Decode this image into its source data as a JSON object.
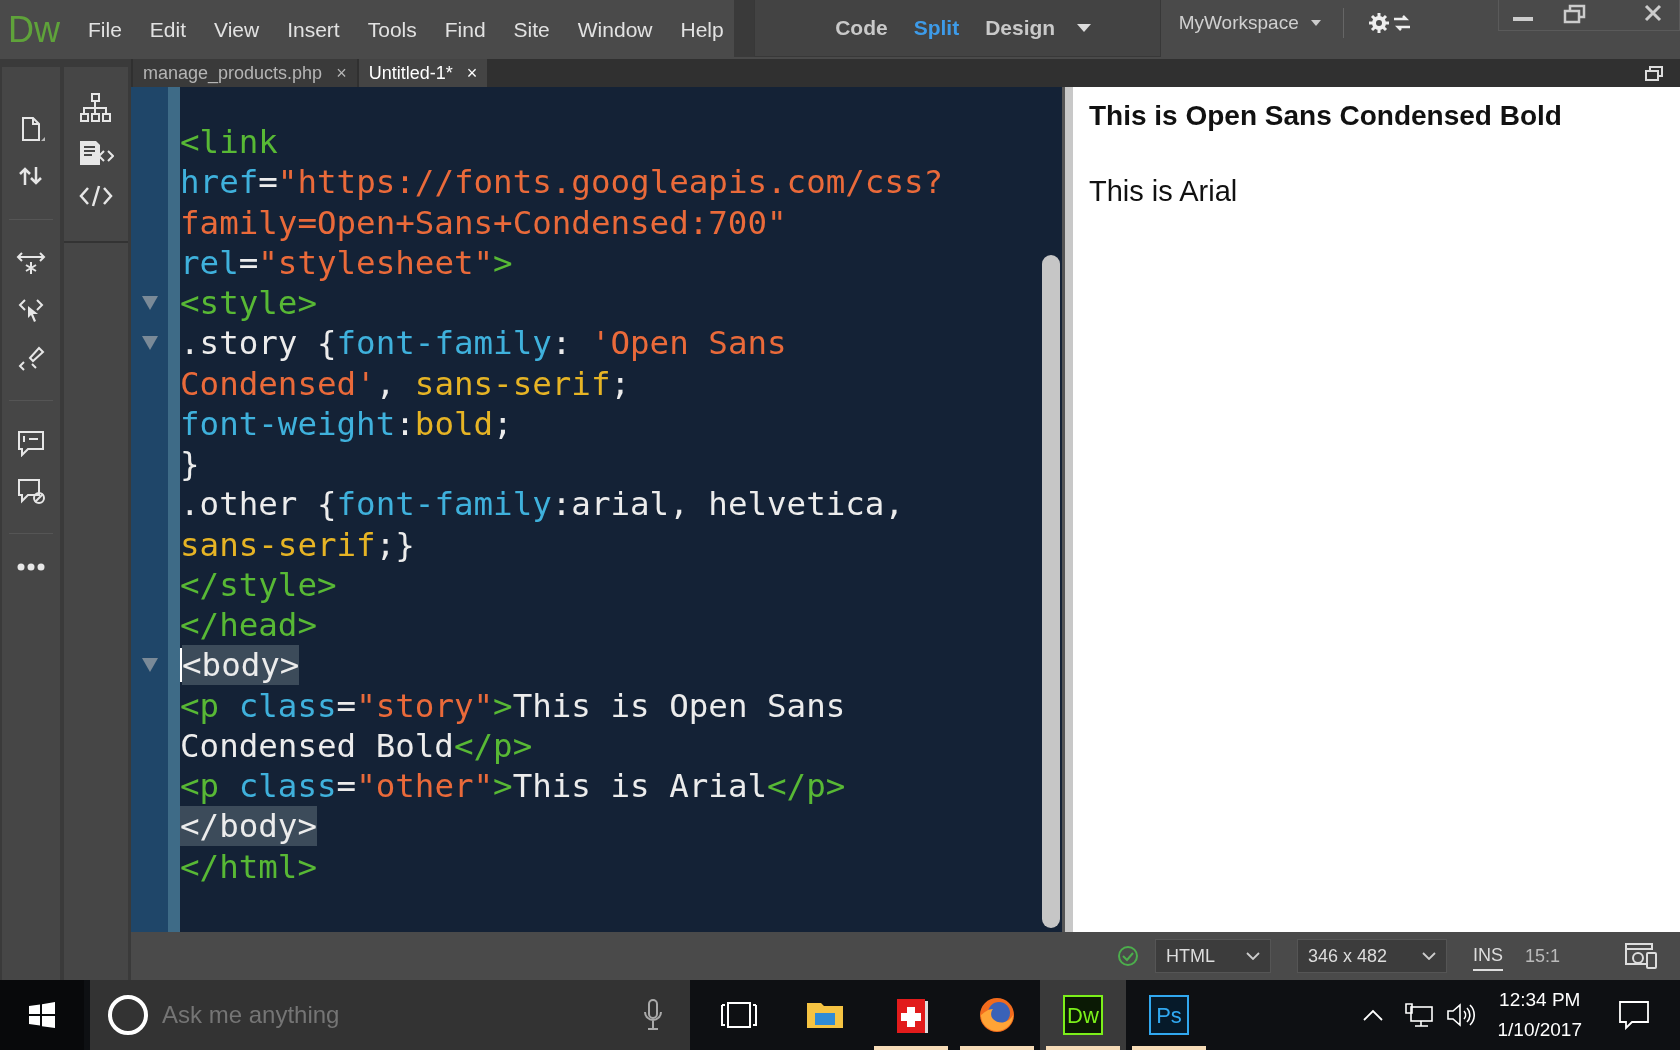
{
  "menu_bar": {
    "logo": "Dw",
    "items": [
      "File",
      "Edit",
      "View",
      "Insert",
      "Tools",
      "Find",
      "Site",
      "Window",
      "Help"
    ]
  },
  "view_switcher": [
    {
      "label": "Code",
      "selected": false
    },
    {
      "label": "Split",
      "selected": true
    },
    {
      "label": "Design",
      "selected": false
    }
  ],
  "workspace": "MyWorkspace",
  "tabs": [
    {
      "label": "manage_products.php",
      "close": "×",
      "selected": false
    },
    {
      "label": "Untitled-1*",
      "close": "×",
      "selected": true
    }
  ],
  "code": {
    "lines": [
      {
        "fold": false,
        "highlighted": false,
        "cursor": false,
        "tokens": [
          {
            "kind": "tag",
            "text": "<link"
          }
        ]
      },
      {
        "fold": false,
        "highlighted": false,
        "cursor": false,
        "tokens": [
          {
            "kind": "attr",
            "text": "href"
          },
          {
            "kind": "plain",
            "text": "="
          },
          {
            "kind": "string",
            "text": "\"https://fonts.googleapis.com/css?"
          }
        ]
      },
      {
        "fold": false,
        "highlighted": false,
        "cursor": false,
        "tokens": [
          {
            "kind": "string",
            "text": "family=Open+Sans+Condensed:700\""
          }
        ]
      },
      {
        "fold": false,
        "highlighted": false,
        "cursor": false,
        "tokens": [
          {
            "kind": "attr",
            "text": "rel"
          },
          {
            "kind": "plain",
            "text": "="
          },
          {
            "kind": "string",
            "text": "\"stylesheet\""
          },
          {
            "kind": "tag",
            "text": ">"
          }
        ]
      },
      {
        "fold": true,
        "highlighted": false,
        "cursor": false,
        "tokens": [
          {
            "kind": "tag",
            "text": "<style>"
          }
        ]
      },
      {
        "fold": true,
        "highlighted": false,
        "cursor": false,
        "tokens": [
          {
            "kind": "plain",
            "text": ".story {"
          },
          {
            "kind": "prop",
            "text": "font-family"
          },
          {
            "kind": "plain",
            "text": ": "
          },
          {
            "kind": "string",
            "text": "'Open Sans"
          }
        ]
      },
      {
        "fold": false,
        "highlighted": false,
        "cursor": false,
        "tokens": [
          {
            "kind": "string",
            "text": "Condensed'"
          },
          {
            "kind": "plain",
            "text": ", "
          },
          {
            "kind": "value",
            "text": "sans-serif"
          },
          {
            "kind": "plain",
            "text": ";"
          }
        ]
      },
      {
        "fold": false,
        "highlighted": false,
        "cursor": false,
        "tokens": [
          {
            "kind": "prop",
            "text": "font-weight"
          },
          {
            "kind": "plain",
            "text": ":"
          },
          {
            "kind": "value",
            "text": "bold"
          },
          {
            "kind": "plain",
            "text": ";"
          }
        ]
      },
      {
        "fold": false,
        "highlighted": false,
        "cursor": false,
        "tokens": [
          {
            "kind": "plain",
            "text": "}"
          }
        ]
      },
      {
        "fold": false,
        "highlighted": false,
        "cursor": false,
        "tokens": [
          {
            "kind": "plain",
            "text": ".other {"
          },
          {
            "kind": "prop",
            "text": "font-family"
          },
          {
            "kind": "plain",
            "text": ":arial, helvetica,"
          }
        ]
      },
      {
        "fold": false,
        "highlighted": false,
        "cursor": false,
        "tokens": [
          {
            "kind": "value",
            "text": "sans-serif"
          },
          {
            "kind": "plain",
            "text": ";}"
          }
        ]
      },
      {
        "fold": false,
        "highlighted": false,
        "cursor": false,
        "tokens": [
          {
            "kind": "tag",
            "text": "</style>"
          }
        ]
      },
      {
        "fold": false,
        "highlighted": false,
        "cursor": false,
        "tokens": [
          {
            "kind": "tag",
            "text": "</head>"
          }
        ]
      },
      {
        "fold": true,
        "highlighted": true,
        "cursor": true,
        "tokens": [
          {
            "kind": "tag",
            "text": "<body>"
          }
        ]
      },
      {
        "fold": false,
        "highlighted": false,
        "cursor": false,
        "tokens": [
          {
            "kind": "tag",
            "text": "<p "
          },
          {
            "kind": "attr",
            "text": "class"
          },
          {
            "kind": "plain",
            "text": "="
          },
          {
            "kind": "string",
            "text": "\"story\""
          },
          {
            "kind": "tag",
            "text": ">"
          },
          {
            "kind": "plain",
            "text": "This is Open Sans"
          }
        ]
      },
      {
        "fold": false,
        "highlighted": false,
        "cursor": false,
        "tokens": [
          {
            "kind": "plain",
            "text": "Condensed Bold"
          },
          {
            "kind": "tag",
            "text": "</p>"
          }
        ]
      },
      {
        "fold": false,
        "highlighted": false,
        "cursor": false,
        "tokens": [
          {
            "kind": "tag",
            "text": "<p "
          },
          {
            "kind": "attr",
            "text": "class"
          },
          {
            "kind": "plain",
            "text": "="
          },
          {
            "kind": "string",
            "text": "\"other\""
          },
          {
            "kind": "tag",
            "text": ">"
          },
          {
            "kind": "plain",
            "text": "This is Arial"
          },
          {
            "kind": "tag",
            "text": "</p>"
          }
        ]
      },
      {
        "fold": false,
        "highlighted": true,
        "cursor": false,
        "tokens": [
          {
            "kind": "tag",
            "text": "</body>"
          }
        ]
      },
      {
        "fold": false,
        "highlighted": false,
        "cursor": false,
        "tokens": [
          {
            "kind": "tag",
            "text": "</html>"
          }
        ]
      }
    ]
  },
  "design": {
    "paragraphs": [
      {
        "text": "This is Open Sans Condensed Bold",
        "bold": true
      },
      {
        "text": "This is Arial",
        "bold": false
      }
    ]
  },
  "status_bar": {
    "document_type": "HTML",
    "window_size": "346 x 482",
    "mode": "INS",
    "position": "15:1"
  },
  "taskbar": {
    "search": {
      "placeholder": "Ask me anything"
    },
    "apps": [
      {
        "kind": "explorer",
        "running": false,
        "selected": false
      },
      {
        "kind": "red-app",
        "running": true,
        "selected": false
      },
      {
        "kind": "firefox",
        "running": true,
        "selected": false
      },
      {
        "kind": "dw",
        "label": "Dw",
        "running": true,
        "selected": true
      },
      {
        "kind": "ps",
        "label": "Ps",
        "running": true,
        "selected": false
      }
    ],
    "time": "12:34 PM",
    "date": "1/10/2017"
  }
}
